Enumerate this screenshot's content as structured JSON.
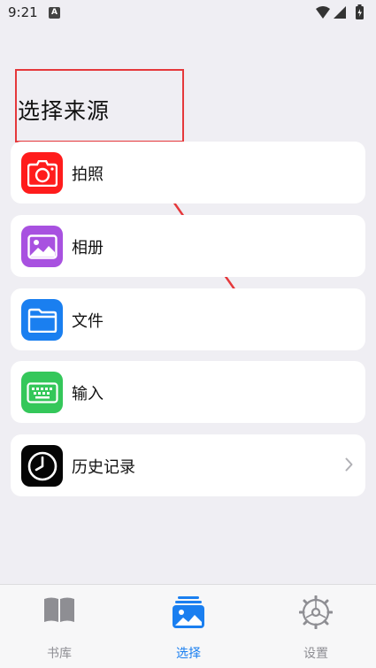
{
  "status_bar": {
    "time": "9:21",
    "notification_badge": "A"
  },
  "page": {
    "title": "选择来源"
  },
  "sources": [
    {
      "label": "拍照",
      "icon": "camera-icon",
      "color": "#ff1c1c"
    },
    {
      "label": "相册",
      "icon": "photo-album-icon",
      "color": "#a851e0"
    },
    {
      "label": "文件",
      "icon": "folder-icon",
      "color": "#1a7ff0"
    },
    {
      "label": "输入",
      "icon": "keyboard-icon",
      "color": "#34c75a"
    },
    {
      "label": "历史记录",
      "icon": "clock-icon",
      "color": "#050505"
    }
  ],
  "tabs": [
    {
      "label": "书库",
      "icon": "book-icon",
      "active": false
    },
    {
      "label": "选择",
      "icon": "photos-stack-icon",
      "active": true
    },
    {
      "label": "设置",
      "icon": "gear-icon",
      "active": false
    }
  ],
  "colors": {
    "accent": "#1a7ff0",
    "inactive": "#8e8e93",
    "annotation": "#e5383b",
    "background": "#efeef3"
  }
}
